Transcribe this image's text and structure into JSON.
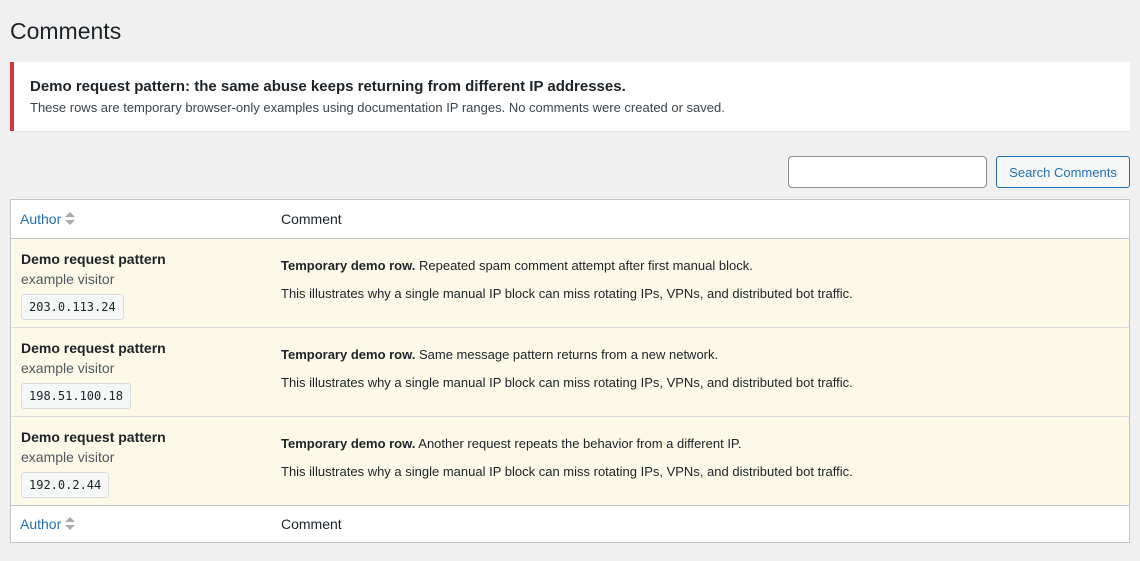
{
  "page": {
    "title": "Comments"
  },
  "notice": {
    "title": "Demo request pattern: the same abuse keeps returning from different IP addresses.",
    "text": "These rows are temporary browser-only examples using documentation IP ranges. No comments were created or saved.",
    "accent_color": "#d63638"
  },
  "search": {
    "value": "",
    "placeholder": "",
    "button_label": "Search Comments"
  },
  "table": {
    "header": {
      "author": "Author",
      "comment": "Comment"
    },
    "footer": {
      "author": "Author",
      "comment": "Comment"
    },
    "rows": [
      {
        "author_name": "Demo request pattern",
        "author_sub": "example visitor",
        "ip": "203.0.113.24",
        "comment_prefix": "Temporary demo row.",
        "comment_text": " Repeated spam comment attempt after first manual block.",
        "comment_note": "This illustrates why a single manual IP block can miss rotating IPs, VPNs, and distributed bot traffic."
      },
      {
        "author_name": "Demo request pattern",
        "author_sub": "example visitor",
        "ip": "198.51.100.18",
        "comment_prefix": "Temporary demo row.",
        "comment_text": " Same message pattern returns from a new network.",
        "comment_note": "This illustrates why a single manual IP block can miss rotating IPs, VPNs, and distributed bot traffic."
      },
      {
        "author_name": "Demo request pattern",
        "author_sub": "example visitor",
        "ip": "192.0.2.44",
        "comment_prefix": "Temporary demo row.",
        "comment_text": " Another request repeats the behavior from a different IP.",
        "comment_note": "This illustrates why a single manual IP block can miss rotating IPs, VPNs, and distributed bot traffic."
      }
    ],
    "row_background": "#fcf9e8",
    "link_color": "#2271b1"
  }
}
